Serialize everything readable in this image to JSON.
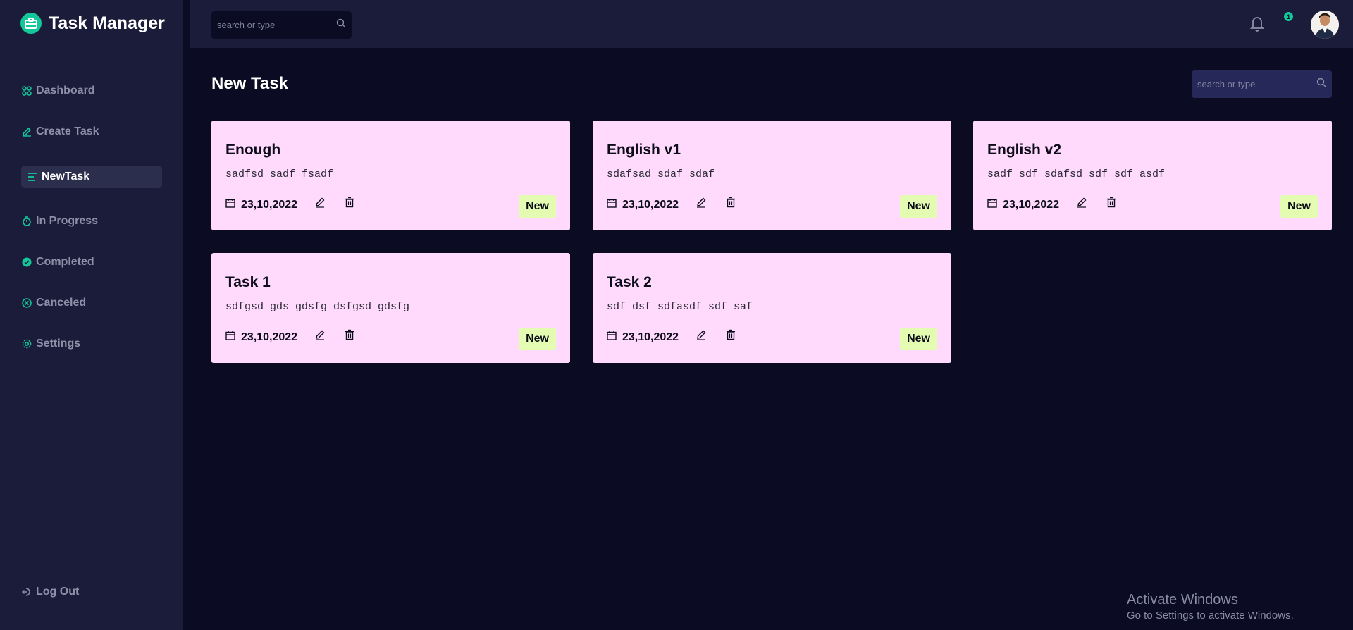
{
  "app": {
    "title": "Task Manager"
  },
  "sidebar": {
    "items": [
      {
        "label": "Dashboard",
        "icon": "dashboard-grid-icon",
        "active": false
      },
      {
        "label": "Create Task",
        "icon": "pencil-icon",
        "active": false
      },
      {
        "label": "NewTask",
        "icon": "list-lines-icon",
        "active": true
      },
      {
        "label": "In Progress",
        "icon": "stopwatch-icon",
        "active": false
      },
      {
        "label": "Completed",
        "icon": "check-circle-icon",
        "active": false
      },
      {
        "label": "Canceled",
        "icon": "x-circle-icon",
        "active": false
      },
      {
        "label": "Settings",
        "icon": "gear-icon",
        "active": false
      }
    ],
    "logout_label": "Log Out"
  },
  "topbar": {
    "search_placeholder": "search or type",
    "notification_count": "1"
  },
  "main": {
    "title": "New Task",
    "search_placeholder": "search or type",
    "cards": [
      {
        "title": "Enough",
        "description": "sadfsd sadf fsadf",
        "date": "23,10,2022",
        "status": "New"
      },
      {
        "title": "English v1",
        "description": "sdafsad sdaf sdaf",
        "date": "23,10,2022",
        "status": "New"
      },
      {
        "title": "English v2",
        "description": "sadf sdf sdafsd sdf sdf asdf",
        "date": "23,10,2022",
        "status": "New"
      },
      {
        "title": "Task 1",
        "description": "sdfgsd gds gdsfg dsfgsd gdsfg",
        "date": "23,10,2022",
        "status": "New"
      },
      {
        "title": "Task 2",
        "description": "sdf dsf sdfasdf sdf saf",
        "date": "23,10,2022",
        "status": "New"
      }
    ]
  },
  "watermark": {
    "line1": "Activate Windows",
    "line2": "Go to Settings to activate Windows."
  },
  "colors": {
    "accent": "#13c79a",
    "card_bg": "#ffdafd",
    "badge_bg": "#e4fcb2",
    "sidebar_bg": "#1b1c3a",
    "page_bg": "#0b0c24"
  }
}
